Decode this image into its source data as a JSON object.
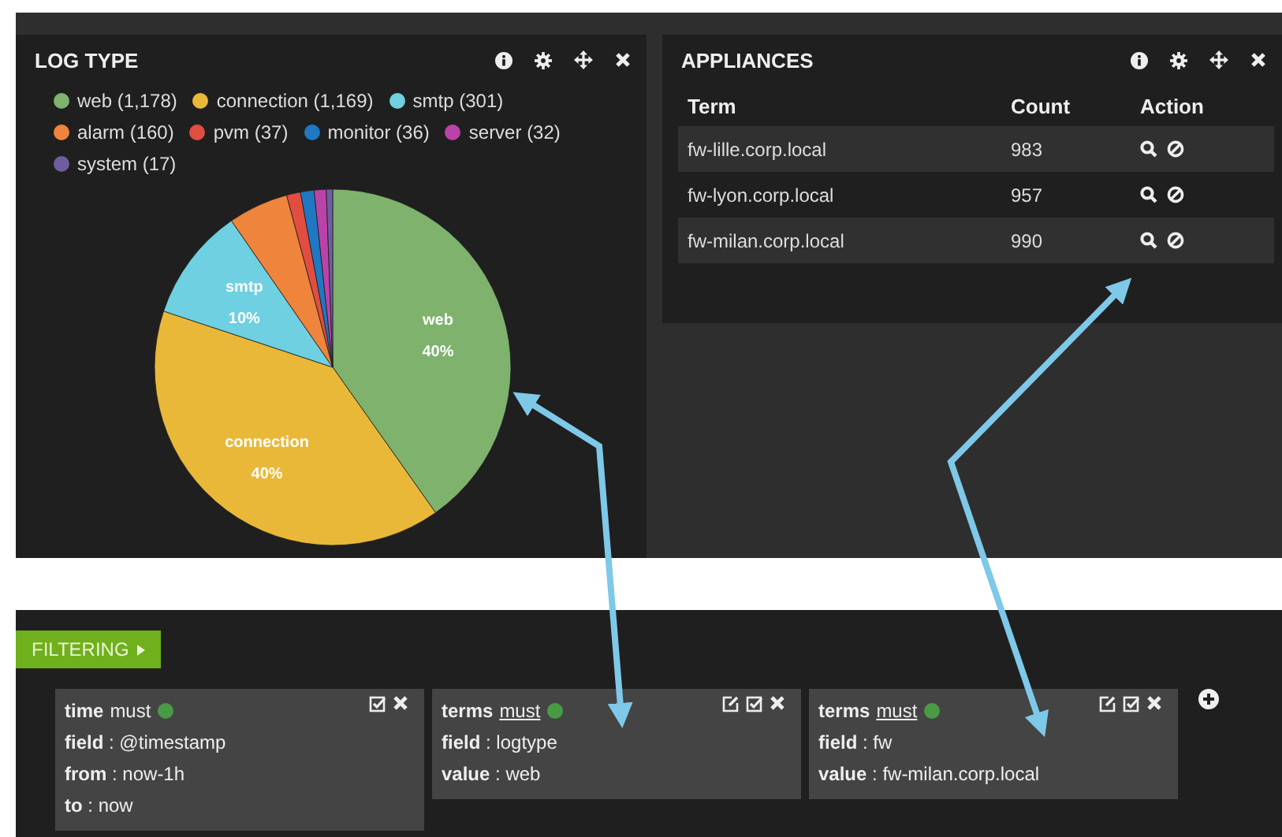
{
  "log_type_panel": {
    "title": "LOG TYPE",
    "legend": [
      {
        "color": "#7eb26d"
      },
      {
        "color": "#eab839"
      },
      {
        "color": "#6ed0e0"
      },
      {
        "color": "#ef843c"
      },
      {
        "color": "#e24d42"
      },
      {
        "color": "#1f78c1"
      },
      {
        "color": "#ba43a9"
      },
      {
        "color": "#705da0"
      }
    ],
    "chart_data": {
      "type": "pie",
      "categories": [
        "web (1,178)",
        "connection (1,169)",
        "smtp (301)",
        "alarm (160)",
        "pvm (37)",
        "monitor (36)",
        "server (32)",
        "system (17)"
      ],
      "values": [
        1178,
        1169,
        301,
        160,
        37,
        36,
        32,
        17
      ],
      "annotations": [
        {
          "x": "web (1,178)",
          "text": "web"
        },
        {
          "x": "web (1,178)",
          "text": "40%"
        },
        {
          "x": "connection (1,169)",
          "text": "connection"
        },
        {
          "x": "connection (1,169)",
          "text": "40%"
        },
        {
          "x": "smtp (301)",
          "text": "smtp"
        },
        {
          "x": "smtp (301)",
          "text": "10%"
        }
      ]
    }
  },
  "appliances_panel": {
    "title": "APPLIANCES",
    "table": {
      "columns": [
        "Term",
        "Count",
        "Action"
      ],
      "rows": [
        {
          "term": "fw-lille.corp.local",
          "count": "983"
        },
        {
          "term": "fw-lyon.corp.local",
          "count": "957"
        },
        {
          "term": "fw-milan.corp.local",
          "count": "990"
        }
      ]
    }
  },
  "filtering": {
    "button": "FILTERING",
    "filters": [
      {
        "type": "time",
        "mode": "must",
        "mode_link": false,
        "color": "#4a9a45",
        "editable": false,
        "fields": [
          {
            "key": "field",
            "value": ": @timestamp"
          },
          {
            "key": "from",
            "value": ": now-1h"
          },
          {
            "key": "to",
            "value": ": now"
          }
        ]
      },
      {
        "type": "terms",
        "mode": "must",
        "mode_link": true,
        "color": "#4a9a45",
        "editable": true,
        "fields": [
          {
            "key": "field",
            "value": ": logtype"
          },
          {
            "key": "value",
            "value": ": web"
          }
        ]
      },
      {
        "type": "terms",
        "mode": "must",
        "mode_link": true,
        "color": "#4a9a45",
        "editable": true,
        "fields": [
          {
            "key": "field",
            "value": ": fw"
          },
          {
            "key": "value",
            "value": ": fw-milan.corp.local"
          }
        ]
      }
    ]
  }
}
